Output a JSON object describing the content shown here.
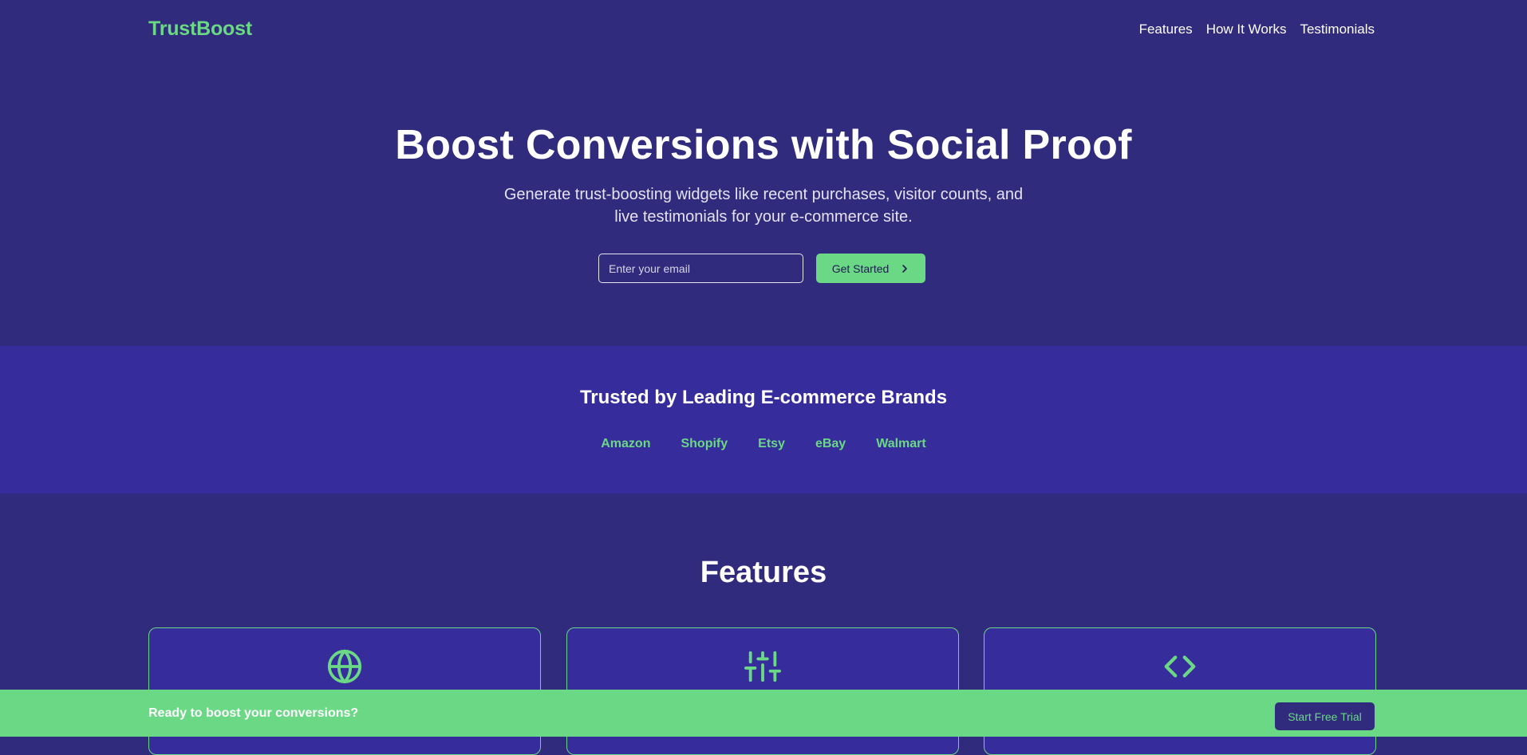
{
  "colors": {
    "background": "#302b7d",
    "band": "#372c9c",
    "accent": "#6ad884",
    "text": "#ffffff"
  },
  "header": {
    "logo": "TrustBoost",
    "nav": [
      {
        "label": "Features"
      },
      {
        "label": "How It Works"
      },
      {
        "label": "Testimonials"
      }
    ]
  },
  "hero": {
    "title": "Boost Conversions with Social Proof",
    "subtitle": "Generate trust-boosting widgets like recent purchases, visitor counts, and live testimonials for your e-commerce site.",
    "email_placeholder": "Enter your email",
    "email_value": "",
    "cta_label": "Get Started",
    "cta_icon": "chevron-right-icon"
  },
  "trusted": {
    "title": "Trusted by Leading E-commerce Brands",
    "brands": [
      "Amazon",
      "Shopify",
      "Etsy",
      "eBay",
      "Walmart"
    ]
  },
  "features": {
    "title": "Features",
    "cards": [
      {
        "icon": "globe-icon"
      },
      {
        "icon": "sliders-icon"
      },
      {
        "icon": "code-icon"
      }
    ]
  },
  "cta_bar": {
    "text": "Ready to boost your conversions?",
    "button_label": "Start Free Trial"
  }
}
